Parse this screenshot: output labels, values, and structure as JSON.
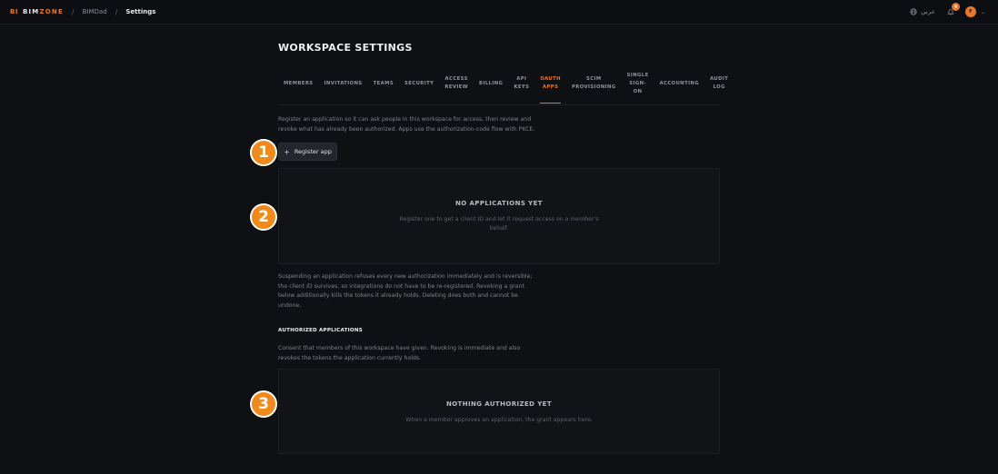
{
  "topbar": {
    "brand_mark": "BI",
    "brand_word_a": "BIM",
    "brand_word_b": "ZONE",
    "breadcrumb": [
      "BIMDad",
      "Settings"
    ],
    "separator": "/",
    "language": "عربي",
    "notification_count": "4",
    "avatar_initial": "F"
  },
  "page": {
    "title": "WORKSPACE SETTINGS"
  },
  "tabs": [
    {
      "label": "MEMBERS",
      "active": false
    },
    {
      "label": "INVITATIONS",
      "active": false
    },
    {
      "label": "TEAMS",
      "active": false
    },
    {
      "label": "SECURITY",
      "active": false
    },
    {
      "label": "ACCESS\nREVIEW",
      "active": false
    },
    {
      "label": "BILLING",
      "active": false
    },
    {
      "label": "API\nKEYS",
      "active": false
    },
    {
      "label": "OAUTH\nAPPS",
      "active": true
    },
    {
      "label": "SCIM\nPROVISIONING",
      "active": false
    },
    {
      "label": "SINGLE\nSIGN-\nON",
      "active": false
    },
    {
      "label": "ACCOUNTING",
      "active": false
    },
    {
      "label": "AUDIT\nLOG",
      "active": false
    }
  ],
  "oauth": {
    "intro_line1": "Register an application so it can ask people in this workspace for access, then review and",
    "intro_line2": "revoke what has already been authorized. Apps use the authorization-code flow with PKCE.",
    "register_label": "Register app",
    "empty_title": "NO APPLICATIONS YET",
    "empty_line1": "Register one to get a client ID and let it request access on a member's",
    "empty_line2": "behalf.",
    "suspend_line1": "Suspending an application refuses every new authorization immediately and is reversible;",
    "suspend_line2": "the client ID survives, so integrations do not have to be re-registered. Revoking a grant",
    "suspend_line3": "below additionally kills the tokens it already holds. Deleting does both and cannot be",
    "suspend_line4": "undone.",
    "authorized_heading": "AUTHORIZED APPLICATIONS",
    "consent_line1": "Consent that members of this workspace have given. Revoking is immediate and also",
    "consent_line2": "revokes the tokens the application currently holds.",
    "nothing_title": "NOTHING AUTHORIZED YET",
    "nothing_line": "When a member approves an application, the grant appears here."
  },
  "markers": [
    "1",
    "2",
    "3"
  ],
  "colors": {
    "accent": "#e8772a",
    "marker": "#f08a1c",
    "background": "#0f1013"
  }
}
